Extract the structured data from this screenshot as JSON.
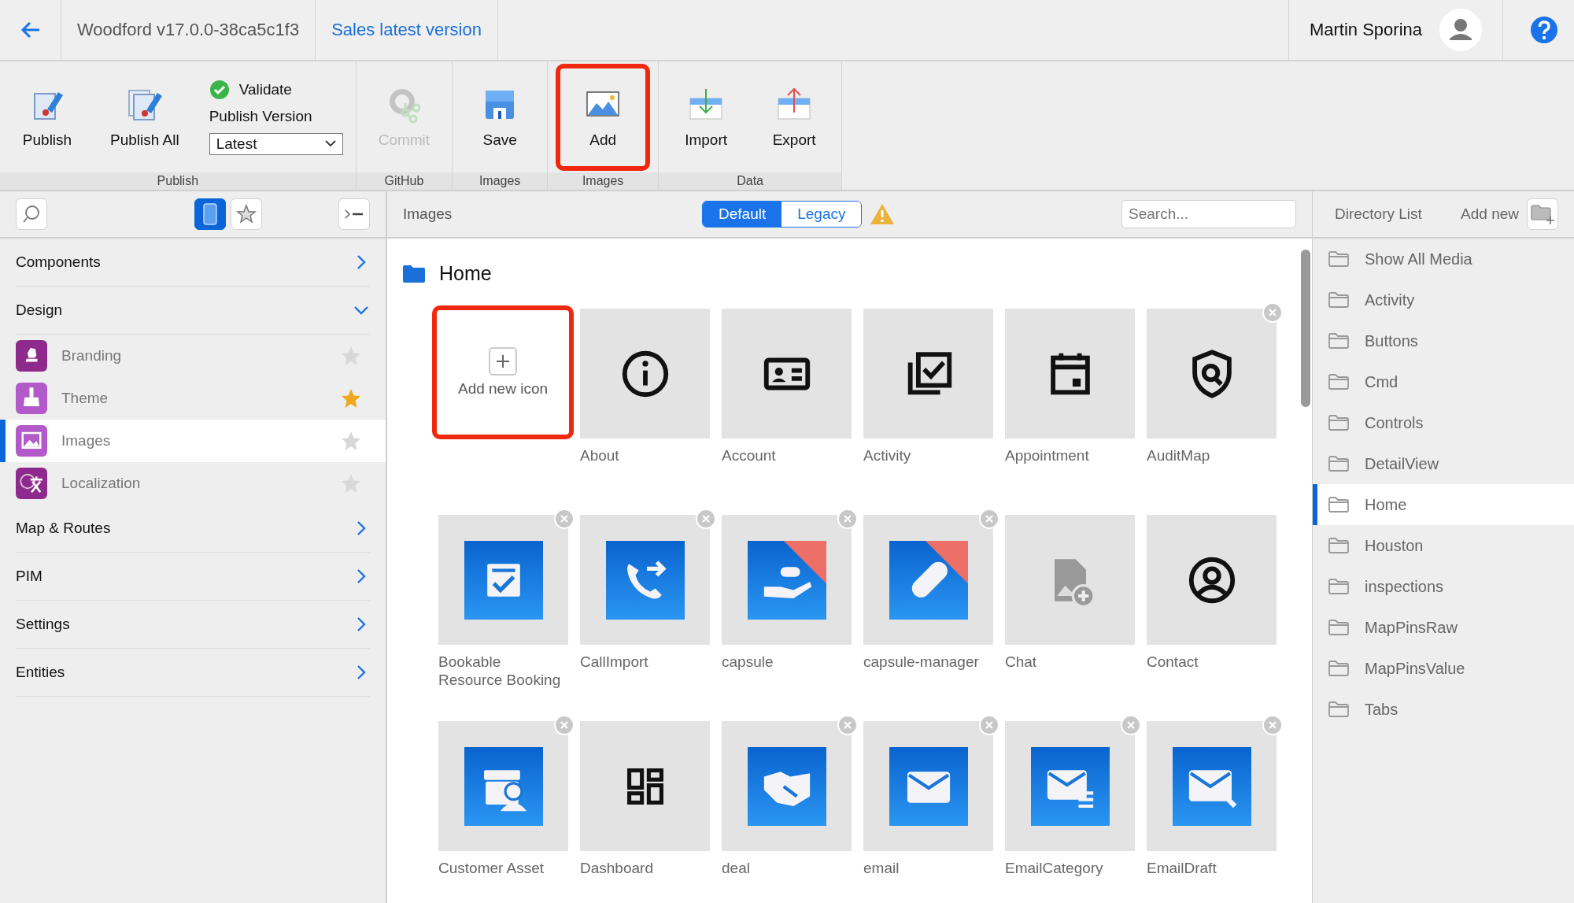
{
  "top_bar": {
    "project": "Woodford v17.0.0-38ca5c1f3",
    "version_link": "Sales latest version",
    "user_name": "Martin Sporina"
  },
  "ribbon": {
    "groups": [
      {
        "label": "Publish",
        "items": [
          {
            "kind": "button",
            "label": "Publish",
            "disabled": false,
            "highlighted": false
          },
          {
            "kind": "button",
            "label": "Publish All",
            "disabled": false,
            "highlighted": false
          },
          {
            "kind": "version",
            "validate": "Validate",
            "version_label": "Publish Version",
            "version_value": "Latest"
          }
        ]
      },
      {
        "label": "GitHub",
        "items": [
          {
            "kind": "button",
            "label": "Commit",
            "disabled": true,
            "highlighted": false
          }
        ]
      },
      {
        "label": "Images",
        "items": [
          {
            "kind": "button",
            "label": "Save",
            "disabled": false,
            "highlighted": false
          }
        ]
      },
      {
        "label": "Images",
        "items": [
          {
            "kind": "button",
            "label": "Add",
            "disabled": false,
            "highlighted": true
          }
        ]
      },
      {
        "label": "Data",
        "items": [
          {
            "kind": "button",
            "label": "Import",
            "disabled": false,
            "highlighted": false
          },
          {
            "kind": "button",
            "label": "Export",
            "disabled": false,
            "highlighted": false
          }
        ]
      }
    ]
  },
  "sidebar": {
    "view_toggles": [
      {
        "selected": true
      },
      {
        "selected": false
      }
    ],
    "sections": [
      {
        "label": "Components",
        "expanded": false
      },
      {
        "label": "Design",
        "expanded": true,
        "children": [
          {
            "label": "Branding",
            "favorite": false,
            "selected": false
          },
          {
            "label": "Theme",
            "favorite": true,
            "selected": false
          },
          {
            "label": "Images",
            "favorite": false,
            "selected": true
          },
          {
            "label": "Localization",
            "favorite": false,
            "selected": false
          }
        ]
      },
      {
        "label": "Map & Routes",
        "expanded": false
      },
      {
        "label": "PIM",
        "expanded": false
      },
      {
        "label": "Settings",
        "expanded": false
      },
      {
        "label": "Entities",
        "expanded": false
      }
    ]
  },
  "content": {
    "title": "Images",
    "modes": [
      {
        "label": "Default",
        "selected": true
      },
      {
        "label": "Legacy",
        "selected": false
      }
    ],
    "search": {
      "placeholder": "Search..."
    },
    "folder": "Home",
    "tiles": [
      {
        "kind": "add",
        "label": "Add new icon",
        "highlighted": true
      },
      {
        "kind": "glyph",
        "label": "About",
        "removable": false
      },
      {
        "kind": "glyph",
        "label": "Account",
        "removable": false
      },
      {
        "kind": "glyph",
        "label": "Activity",
        "removable": false
      },
      {
        "kind": "glyph",
        "label": "Appointment",
        "removable": false
      },
      {
        "kind": "glyph",
        "label": "AuditMap",
        "removable": true
      },
      {
        "kind": "blue",
        "label": "Bookable Resource Booking",
        "removable": true,
        "flagged": false
      },
      {
        "kind": "blue",
        "label": "CallImport",
        "removable": true,
        "flagged": false
      },
      {
        "kind": "blue",
        "label": "capsule",
        "removable": true,
        "flagged": true
      },
      {
        "kind": "blue",
        "label": "capsule-manager",
        "removable": true,
        "flagged": true
      },
      {
        "kind": "file",
        "label": "Chat",
        "removable": false
      },
      {
        "kind": "glyph",
        "label": "Contact",
        "removable": false
      },
      {
        "kind": "blue",
        "label": "Customer Asset",
        "removable": true,
        "flagged": false
      },
      {
        "kind": "glyph",
        "label": "Dashboard",
        "removable": false
      },
      {
        "kind": "blue",
        "label": "deal",
        "removable": true,
        "flagged": false
      },
      {
        "kind": "blue",
        "label": "email",
        "removable": true,
        "flagged": false
      },
      {
        "kind": "blue",
        "label": "EmailCategory",
        "removable": true,
        "flagged": false
      },
      {
        "kind": "blue",
        "label": "EmailDraft",
        "removable": true,
        "flagged": false
      }
    ]
  },
  "directory": {
    "title": "Directory List",
    "add_label": "Add new",
    "folders": [
      {
        "label": "Show All Media",
        "selected": false
      },
      {
        "label": "Activity",
        "selected": false
      },
      {
        "label": "Buttons",
        "selected": false
      },
      {
        "label": "Cmd",
        "selected": false
      },
      {
        "label": "Controls",
        "selected": false
      },
      {
        "label": "DetailView",
        "selected": false
      },
      {
        "label": "Home",
        "selected": true
      },
      {
        "label": "Houston",
        "selected": false
      },
      {
        "label": "inspections",
        "selected": false
      },
      {
        "label": "MapPinsRaw",
        "selected": false
      },
      {
        "label": "MapPinsValue",
        "selected": false
      },
      {
        "label": "Tabs",
        "selected": false
      }
    ]
  }
}
